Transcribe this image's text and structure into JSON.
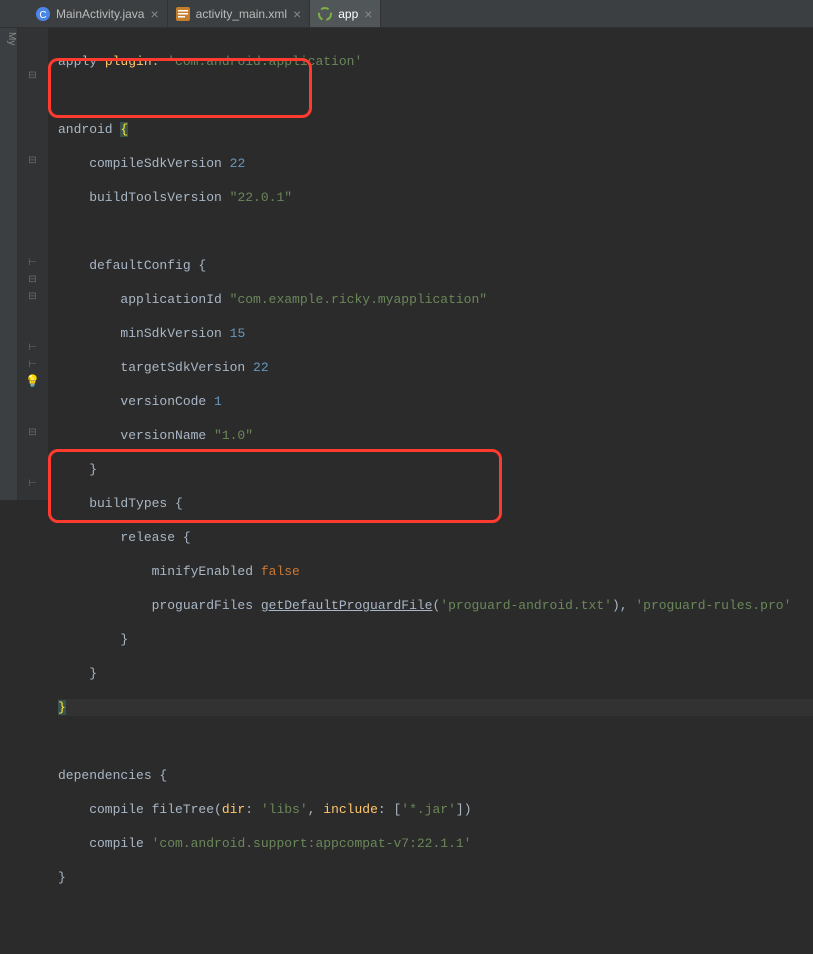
{
  "tabs": [
    {
      "label": "MainActivity.java",
      "icon": "C",
      "iconColor": "#4a86e8"
    },
    {
      "label": "activity_main.xml",
      "icon": "xml",
      "iconColor": "#c57e29"
    },
    {
      "label": "app",
      "icon": "gradle",
      "iconColor": "#7cb342",
      "active": true
    }
  ],
  "sidebarLabel": "My",
  "code": {
    "l1": {
      "a": "apply ",
      "b": "plugin",
      "c": ": ",
      "d": "'com.android.application'"
    },
    "l3a": "android ",
    "l3b": "{",
    "l4": {
      "a": "    compileSdkVersion ",
      "b": "22"
    },
    "l5": {
      "a": "    buildToolsVersion ",
      "b": "\"22.0.1\""
    },
    "l7": "    defaultConfig {",
    "l8": {
      "a": "        applicationId ",
      "b": "\"com.example.ricky.myapplication\""
    },
    "l9": {
      "a": "        minSdkVersion ",
      "b": "15"
    },
    "l10": {
      "a": "        targetSdkVersion ",
      "b": "22"
    },
    "l11": {
      "a": "        versionCode ",
      "b": "1"
    },
    "l12": {
      "a": "        versionName ",
      "b": "\"1.0\""
    },
    "l13": "    }",
    "l14": "    buildTypes {",
    "l15": "        release {",
    "l16": {
      "a": "            minifyEnabled ",
      "b": "false"
    },
    "l17": {
      "a": "            proguardFiles ",
      "b": "getDefaultProguardFile",
      "c": "(",
      "d": "'proguard-android.txt'",
      "e": "), ",
      "f": "'proguard-rules.pro'"
    },
    "l18": "        }",
    "l19": "    }",
    "l20": "}",
    "l22": "dependencies {",
    "l23": {
      "a": "    compile fileTree(",
      "b": "dir",
      "c": ": ",
      "d": "'libs'",
      "e": ", ",
      "f": "include",
      "g": ": [",
      "h": "'*.jar'",
      "i": "])"
    },
    "l24": {
      "a": "    compile ",
      "b": "'com.android.support:appcompat-v7:22.1.1'"
    },
    "l25": "}"
  }
}
